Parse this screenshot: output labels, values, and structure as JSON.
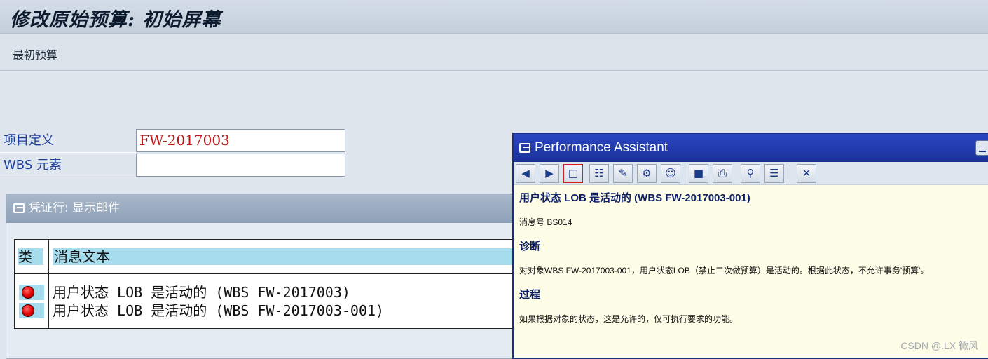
{
  "window": {
    "title": "修改原始预算: 初始屏幕"
  },
  "toolbar": {
    "original_budget_label": "最初预算"
  },
  "form": {
    "project_label": "项目定义",
    "project_value": "FW-2017003",
    "wbs_label": "WBS 元素",
    "wbs_value": ""
  },
  "log_panel": {
    "title": "凭证行: 显示邮件",
    "columns": {
      "type": "类",
      "message": "消息文本"
    },
    "rows": [
      {
        "status_icon": "red-light-icon",
        "text": "用户状态 LOB 是活动的 (WBS FW-2017003)"
      },
      {
        "status_icon": "red-light-icon",
        "text": "用户状态 LOB 是活动的 (WBS FW-2017003-001)"
      }
    ]
  },
  "assistant": {
    "title": "Performance Assistant",
    "toolbar_icons": [
      "back-arrow-icon",
      "forward-arrow-icon",
      "book-icon",
      "tree-icon",
      "edit-icon",
      "technical-info-icon",
      "person-icon",
      "bookmark-icon",
      "print-icon",
      "search-icon",
      "notes-icon",
      "close-icon"
    ],
    "heading": "用户状态 LOB 是活动的 (WBS FW-2017003-001)",
    "message_no": "消息号 BS014",
    "diagnosis_title": "诊断",
    "diagnosis_text": "对对象WBS FW-2017003-001，用户状态LOB（禁止二次做预算）是活动的。根据此状态，不允许事务'预算'。",
    "procedure_title": "过程",
    "procedure_text": "如果根据对象的状态，这是允许的，仅可执行要求的功能。"
  },
  "watermark": "CSDN @.LX 微风",
  "colors": {
    "title_blue": "#1a3298",
    "status_red": "#e00000",
    "header_cyan": "#a5dcee"
  }
}
